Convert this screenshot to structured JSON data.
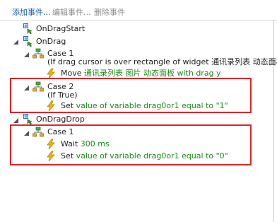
{
  "toolbar": {
    "add_label": "添加事件...",
    "edit_label": "编辑事件...",
    "delete_label": "删除事件"
  },
  "tree": {
    "on_drag_start": {
      "label": "OnDragStart"
    },
    "on_drag": {
      "label": "OnDrag",
      "case1": {
        "label": "Case 1",
        "condition": "(If drag cursor is over rectangle of widget 通讯录列表 动态面板)",
        "action_verb": "Move",
        "action_detail": "通讯录列表 图片 动态面板 with drag y"
      },
      "case2": {
        "label": "Case 2",
        "condition": "(If True)",
        "action_verb": "Set",
        "action_detail": "value of variable drag0or1 equal to \"1\""
      }
    },
    "on_drag_drop": {
      "label": "OnDragDrop",
      "case1": {
        "label": "Case 1",
        "wait_verb": "Wait",
        "wait_detail": "300 ms",
        "action_verb": "Set",
        "action_detail": "value of variable drag0or1 equal to \"0\""
      }
    }
  },
  "colors": {
    "highlight_box": "#e0242a",
    "action_text": "#1a8c1a",
    "link": "#1b5dab"
  }
}
